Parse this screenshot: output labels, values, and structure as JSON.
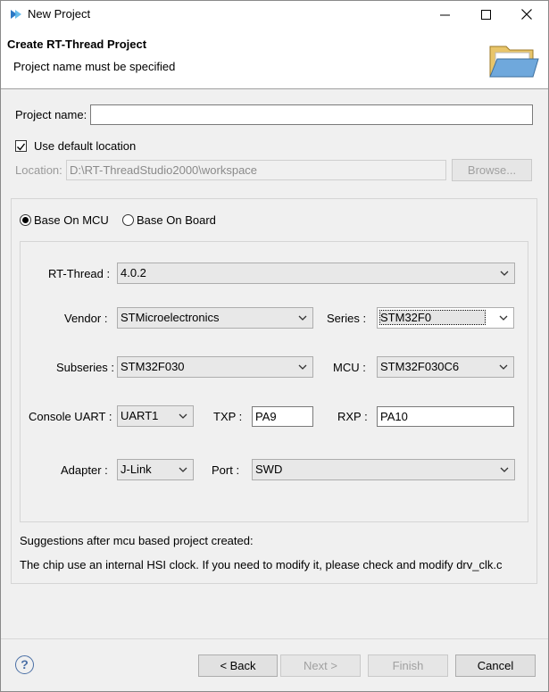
{
  "window": {
    "title": "New Project"
  },
  "banner": {
    "title": "Create RT-Thread Project",
    "message": "Project name must be specified"
  },
  "project": {
    "name_label": "Project name:",
    "name_value": "",
    "use_default_label": "Use default location",
    "location_label": "Location:",
    "location_value": "D:\\RT-ThreadStudio2000\\workspace",
    "browse_label": "Browse..."
  },
  "mode": {
    "mcu_label": "Base On MCU",
    "board_label": "Base On Board",
    "selected": "mcu"
  },
  "config": {
    "rtthread_label": "RT-Thread :",
    "rtthread_value": "4.0.2",
    "vendor_label": "Vendor :",
    "vendor_value": "STMicroelectronics",
    "series_label": "Series :",
    "series_value": "STM32F0",
    "subseries_label": "Subseries :",
    "subseries_value": "STM32F030",
    "mcu_label": "MCU :",
    "mcu_value": "STM32F030C6",
    "uart_label": "Console UART :",
    "uart_value": "UART1",
    "txp_label": "TXP :",
    "txp_value": "PA9",
    "rxp_label": "RXP :",
    "rxp_value": "PA10",
    "adapter_label": "Adapter :",
    "adapter_value": "J-Link",
    "port_label": "Port :",
    "port_value": "SWD"
  },
  "suggestions": {
    "heading": "Suggestions after mcu based project created:",
    "text": "The chip use an internal HSI clock. If you need to modify it, please check and modify drv_clk.c"
  },
  "footer": {
    "back_label": "< Back",
    "next_label": "Next >",
    "finish_label": "Finish",
    "cancel_label": "Cancel"
  }
}
